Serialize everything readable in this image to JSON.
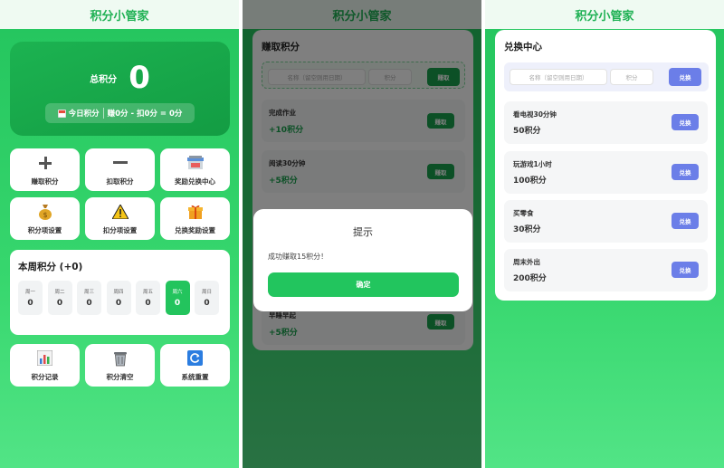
{
  "app_title": "积分小管家",
  "home": {
    "total_label": "总积分",
    "total_value": "0",
    "today": {
      "label": "今日积分",
      "formula": "赚0分 - 扣0分 = 0分"
    },
    "actions": [
      "赚取积分",
      "扣取积分",
      "奖励兑换中心",
      "积分项设置",
      "扣分项设置",
      "兑换奖励设置"
    ],
    "week": {
      "title": "本周积分 (+0)",
      "days": [
        {
          "name": "周一",
          "value": "0"
        },
        {
          "name": "周二",
          "value": "0"
        },
        {
          "name": "周三",
          "value": "0"
        },
        {
          "name": "周四",
          "value": "0"
        },
        {
          "name": "周五",
          "value": "0"
        },
        {
          "name": "周六",
          "value": "0",
          "active": true
        },
        {
          "name": "周日",
          "value": "0"
        }
      ]
    },
    "bottom_actions": [
      "积分记录",
      "积分清空",
      "系统重置"
    ]
  },
  "earn": {
    "title": "赚取积分",
    "name_placeholder": "名称（留空则用日期）",
    "points_placeholder": "积分",
    "submit_label": "赚取",
    "tasks": [
      {
        "name": "完成作业",
        "points": "+10积分",
        "button": "赚取"
      },
      {
        "name": "阅读30分钟",
        "points": "+5积分",
        "button": "赚取"
      },
      {
        "name": "早睡早起",
        "points": "+5积分",
        "button": "赚取"
      }
    ],
    "dialog": {
      "title": "提示",
      "message": "成功赚取15积分！",
      "confirm": "确定"
    }
  },
  "shop": {
    "title": "兑换中心",
    "name_placeholder": "名称（留空则用日期）",
    "points_placeholder": "积分",
    "submit_label": "兑换",
    "rewards": [
      {
        "name": "看电视30分钟",
        "points": "50积分",
        "button": "兑换"
      },
      {
        "name": "玩游戏1小时",
        "points": "100积分",
        "button": "兑换"
      },
      {
        "name": "买零食",
        "points": "30积分",
        "button": "兑换"
      },
      {
        "name": "周末外出",
        "points": "200积分",
        "button": "兑换"
      }
    ]
  },
  "colors": {
    "primary_green": "#23c45d",
    "accent_blue": "#6b7ee8"
  },
  "icons": [
    "plus-icon",
    "minus-icon",
    "store-icon",
    "money-bag-icon",
    "warning-icon",
    "gift-icon",
    "bar-chart-icon",
    "trash-icon",
    "refresh-icon",
    "calendar-icon"
  ]
}
